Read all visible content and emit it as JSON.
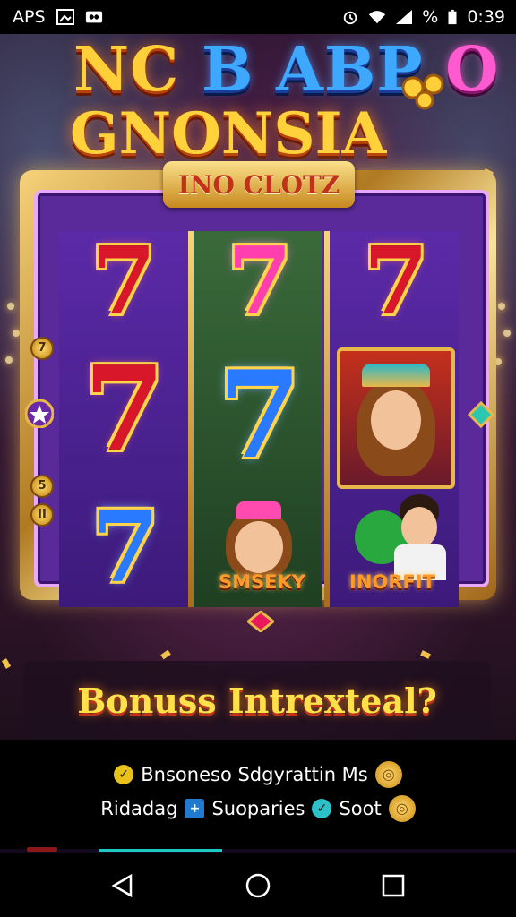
{
  "status_bar": {
    "left_text": "APS",
    "right_pct": "%",
    "time": "0:39",
    "icons": [
      "image-icon",
      "infinity-icon",
      "alarm-icon",
      "wifi-icon",
      "signal-icon",
      "battery-icon"
    ]
  },
  "title": {
    "line1_parts": [
      "NC",
      "B ABP",
      "O"
    ],
    "line1_colors": [
      "#ffcf3a",
      "#3ea8ff",
      "#ff5ad0"
    ],
    "line2": "GNONSIA",
    "badge_icon": "coin-cluster-icon"
  },
  "machine": {
    "banner": "INO CLOTZ",
    "reels": [
      {
        "symbols": [
          "7",
          "7",
          "7"
        ],
        "colors": [
          "red",
          "red",
          "blue"
        ]
      },
      {
        "symbols": [
          "7",
          "7",
          "SMSEKY"
        ],
        "colors": [
          "pink",
          "blue",
          "portrait"
        ]
      },
      {
        "symbols": [
          "7",
          "portrait",
          "INORFIT"
        ],
        "colors": [
          "red",
          "portrait",
          "portrait"
        ]
      }
    ],
    "labels": {
      "reel2_bottom": "SMSEKY",
      "reel3_bottom": "INORFIT"
    },
    "side_gems": [
      "7",
      "5",
      "II"
    ]
  },
  "bonus": {
    "text": "Bonuss Intrexteal?"
  },
  "info": {
    "row1_text": "Bnsoneso Sdgyrattin Ms",
    "row2_part1": "Ridadag",
    "row2_part2": "Suoparies",
    "row2_part3": "Soot"
  },
  "colors": {
    "accent_gold": "#ffd23c",
    "progress": "#1ec9c4"
  }
}
